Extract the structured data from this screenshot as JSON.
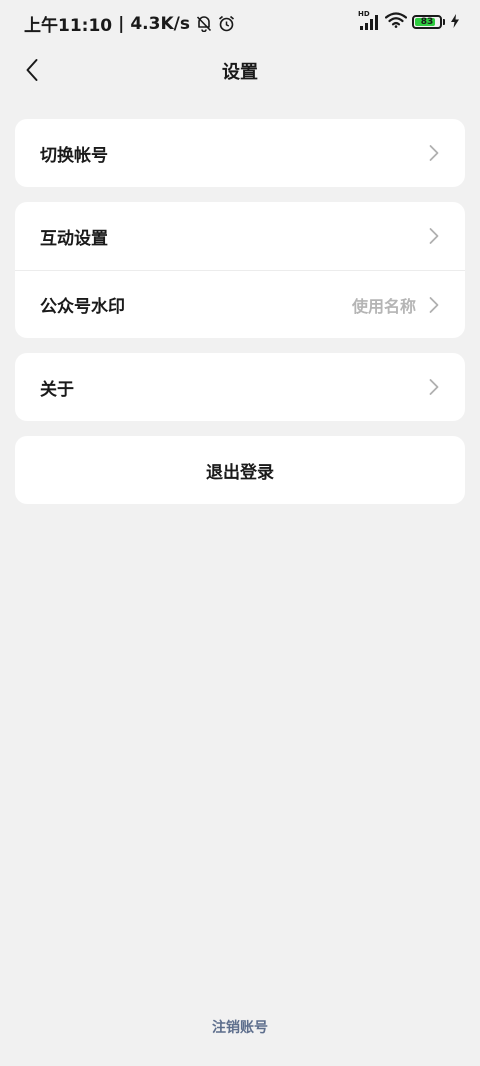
{
  "status_bar": {
    "time": "上午11:10",
    "separator": "|",
    "net_speed": "4.3K/s",
    "hd_label": "HD",
    "battery_level": "83",
    "battery_fraction": 0.83,
    "icons": [
      "bell-muted-icon",
      "alarm-icon",
      "signal-icon",
      "wifi-icon",
      "battery-icon",
      "charging-icon"
    ]
  },
  "header": {
    "title": "设置",
    "back_icon": "chevron-left-icon"
  },
  "groups": [
    {
      "rows": [
        {
          "label": "切换帐号",
          "value": ""
        }
      ]
    },
    {
      "rows": [
        {
          "label": "互动设置",
          "value": ""
        },
        {
          "label": "公众号水印",
          "value": "使用名称"
        }
      ]
    },
    {
      "rows": [
        {
          "label": "关于",
          "value": ""
        }
      ]
    }
  ],
  "logout": {
    "label": "退出登录"
  },
  "footer": {
    "cancel_account_label": "注销账号"
  },
  "colors": {
    "background": "#f1f1f1",
    "card": "#ffffff",
    "footer_link": "#5d6e8c",
    "battery_fill": "#2ecc40",
    "muted_value": "#b5b5b5"
  }
}
